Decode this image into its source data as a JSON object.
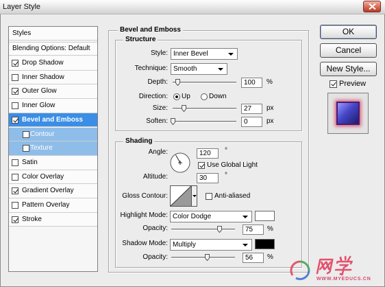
{
  "window": {
    "title": "Layer Style",
    "close_icon": "close-icon"
  },
  "colors": {
    "selection": "#3a8ee6",
    "sub_selection": "#8fbde9",
    "window_bg": "#ececec"
  },
  "styles_list": {
    "header": "Styles",
    "blending": "Blending Options: Default",
    "items": [
      {
        "label": "Drop Shadow",
        "checked": true
      },
      {
        "label": "Inner Shadow",
        "checked": false
      },
      {
        "label": "Outer Glow",
        "checked": true
      },
      {
        "label": "Inner Glow",
        "checked": false
      },
      {
        "label": "Bevel and Emboss",
        "checked": true,
        "selected": true
      },
      {
        "label": "Contour",
        "checked": false
      },
      {
        "label": "Texture",
        "checked": false
      },
      {
        "label": "Satin",
        "checked": false
      },
      {
        "label": "Color Overlay",
        "checked": false
      },
      {
        "label": "Gradient Overlay",
        "checked": true
      },
      {
        "label": "Pattern Overlay",
        "checked": false
      },
      {
        "label": "Stroke",
        "checked": true
      }
    ]
  },
  "panel": {
    "title": "Bevel and Emboss",
    "structure": {
      "title": "Structure",
      "style": {
        "label": "Style:",
        "value": "Inner Bevel"
      },
      "technique": {
        "label": "Technique:",
        "value": "Smooth"
      },
      "depth": {
        "label": "Depth:",
        "value": "100",
        "unit": "%",
        "level": 0.08
      },
      "direction": {
        "label": "Direction:",
        "options": [
          {
            "label": "Up",
            "selected": true
          },
          {
            "label": "Down",
            "selected": false
          }
        ]
      },
      "size": {
        "label": "Size:",
        "value": "27",
        "unit": "px",
        "level": 0.17
      },
      "soften": {
        "label": "Soften:",
        "value": "0",
        "unit": "px",
        "level": 0.0
      }
    },
    "shading": {
      "title": "Shading",
      "angle": {
        "label": "Angle:",
        "value": "120",
        "unit": "°"
      },
      "use_global_light": {
        "label": "Use Global Light",
        "checked": true
      },
      "altitude": {
        "label": "Altitude:",
        "value": "30",
        "unit": "°"
      },
      "gloss_contour": {
        "label": "Gloss Contour:"
      },
      "anti_aliased": {
        "label": "Anti-aliased",
        "checked": false
      },
      "highlight_mode": {
        "label": "Highlight Mode:",
        "value": "Color Dodge",
        "color": "#ffffff"
      },
      "highlight_opacity": {
        "label": "Opacity:",
        "value": "75",
        "unit": "%",
        "level": 0.75
      },
      "shadow_mode": {
        "label": "Shadow Mode:",
        "value": "Multiply",
        "color": "#000000"
      },
      "shadow_opacity": {
        "label": "Opacity:",
        "value": "56",
        "unit": "%",
        "level": 0.56
      }
    }
  },
  "buttons": {
    "ok": "OK",
    "cancel": "Cancel",
    "new_style": "New Style..."
  },
  "preview": {
    "label": "Preview",
    "checked": true
  },
  "watermark": {
    "name": "网学",
    "url": "WWW.MYEDUCS.CN"
  }
}
